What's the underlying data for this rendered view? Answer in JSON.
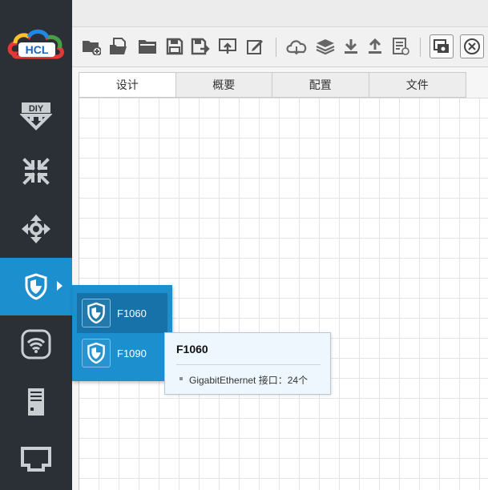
{
  "app": {
    "logo_text": "HCL"
  },
  "sidebar": {
    "items": [
      {
        "icon": "diy-icon",
        "active": false
      },
      {
        "icon": "router-icon",
        "active": false
      },
      {
        "icon": "switch-move-icon",
        "active": false
      },
      {
        "icon": "firewall-shield-icon",
        "active": true
      },
      {
        "icon": "wireless-icon",
        "active": false
      },
      {
        "icon": "server-icon",
        "active": false
      },
      {
        "icon": "network-port-icon",
        "active": false
      }
    ]
  },
  "toolbar": {
    "buttons": [
      "new-folder-icon",
      "open-file-icon",
      "open-folder-icon",
      "save-icon",
      "save-as-icon",
      "export-icon",
      "edit-icon",
      "cloud-icon",
      "layers-icon",
      "download-icon",
      "upload-icon",
      "log-icon",
      "screenshot-icon",
      "topology-view-icon"
    ]
  },
  "tabs": [
    {
      "label": "设计",
      "active": true
    },
    {
      "label": "概要",
      "active": false
    },
    {
      "label": "配置",
      "active": false
    },
    {
      "label": "文件",
      "active": false
    }
  ],
  "flyout": {
    "devices": [
      {
        "label": "F1060",
        "selected": true
      },
      {
        "label": "F1090",
        "selected": false
      }
    ]
  },
  "tooltip": {
    "title": "F1060",
    "interface_line": "GigabitEthernet 接口：24个"
  },
  "colors": {
    "sidebar_bg": "#2b3036",
    "accent_blue": "#1c8fcf",
    "selected_blue": "#1672a8",
    "tooltip_bg": "#eef7fd"
  }
}
